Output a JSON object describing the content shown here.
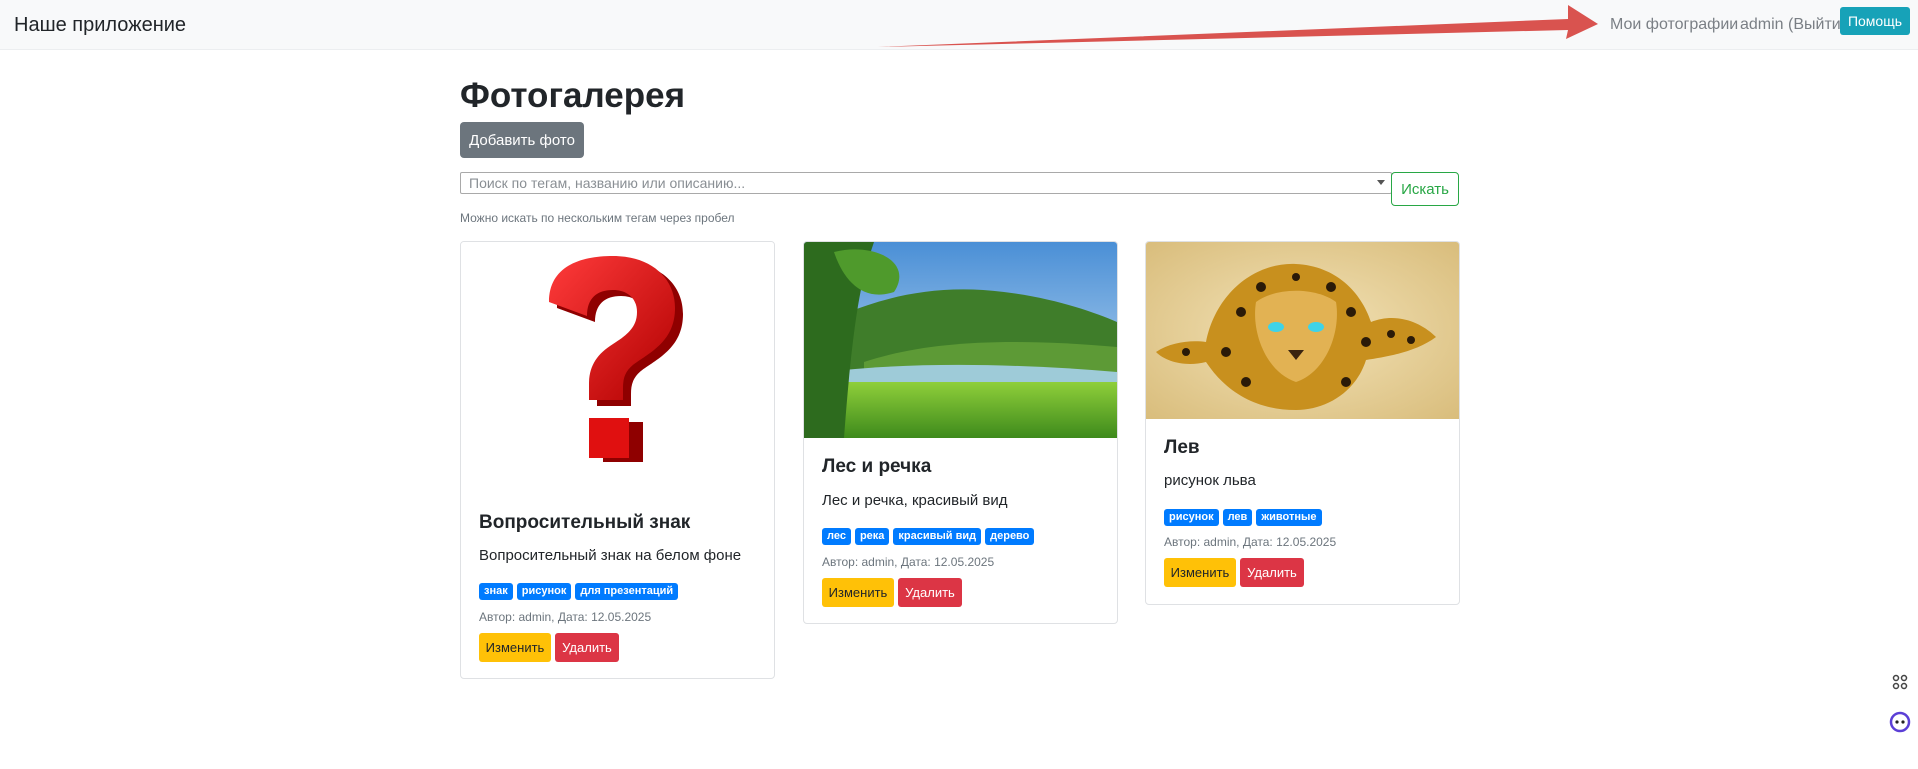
{
  "navbar": {
    "brand": "Наше приложение",
    "photos_link": "Мои фотографии",
    "user_link": "admin (Выйти)",
    "help_button": "Помощь"
  },
  "page": {
    "title": "Фотогалерея",
    "add_button": "Добавить фото",
    "search_placeholder": "Поиск по тегам, названию или описанию...",
    "search_value": "",
    "search_button": "Искать",
    "hint": "Можно искать по нескольким тегам через пробел"
  },
  "cards": [
    {
      "title": "Вопросительный знак",
      "description": "Вопросительный знак на белом фоне",
      "tags": [
        "знак",
        "рисунок",
        "для презентаций"
      ],
      "meta": "Автор: admin, Дата: 12.05.2025",
      "edit": "Изменить",
      "delete": "Удалить",
      "image": "question-mark"
    },
    {
      "title": "Лес и речка",
      "description": "Лес и речка, красивый вид",
      "tags": [
        "лес",
        "река",
        "красивый вид",
        "дерево"
      ],
      "meta": "Автор: admin, Дата: 12.05.2025",
      "edit": "Изменить",
      "delete": "Удалить",
      "image": "forest-river"
    },
    {
      "title": "Лев",
      "description": "рисунок льва",
      "tags": [
        "рисунок",
        "лев",
        "животные"
      ],
      "meta": "Автор: admin, Дата: 12.05.2025",
      "edit": "Изменить",
      "delete": "Удалить",
      "image": "leopard"
    }
  ],
  "colors": {
    "primary": "#007bff",
    "secondary": "#6c757d",
    "success": "#28a745",
    "info": "#17a2b8",
    "warning": "#ffc107",
    "danger": "#dc3545",
    "annotation_arrow": "#d9534f"
  },
  "side_icons": [
    "grid-icon",
    "assistant-icon"
  ]
}
